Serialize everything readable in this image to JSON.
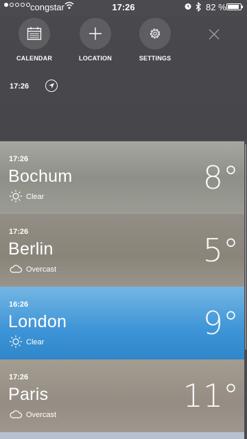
{
  "status_bar": {
    "carrier": "congstar",
    "time": "17:26",
    "battery": "82 %",
    "battery_level": 0.82
  },
  "menu": {
    "calendar_label": "CALENDAR",
    "location_label": "LOCATION",
    "settings_label": "SETTINGS",
    "current_time": "17:26"
  },
  "cities": [
    {
      "time": "17:26",
      "name": "Bochum",
      "condition": "Clear",
      "temp": "8°",
      "icon": "sun-icon"
    },
    {
      "time": "17:26",
      "name": "Berlin",
      "condition": "Overcast",
      "temp": "5°",
      "icon": "cloud-icon"
    },
    {
      "time": "16:26",
      "name": "London",
      "condition": "Clear",
      "temp": "9°",
      "icon": "sun-icon"
    },
    {
      "time": "17:26",
      "name": "Paris",
      "condition": "Overcast",
      "temp": "11°",
      "icon": "cloud-icon"
    }
  ],
  "colors": {
    "menu_bg": "#47474c",
    "london_accent": "#3d94d6"
  }
}
